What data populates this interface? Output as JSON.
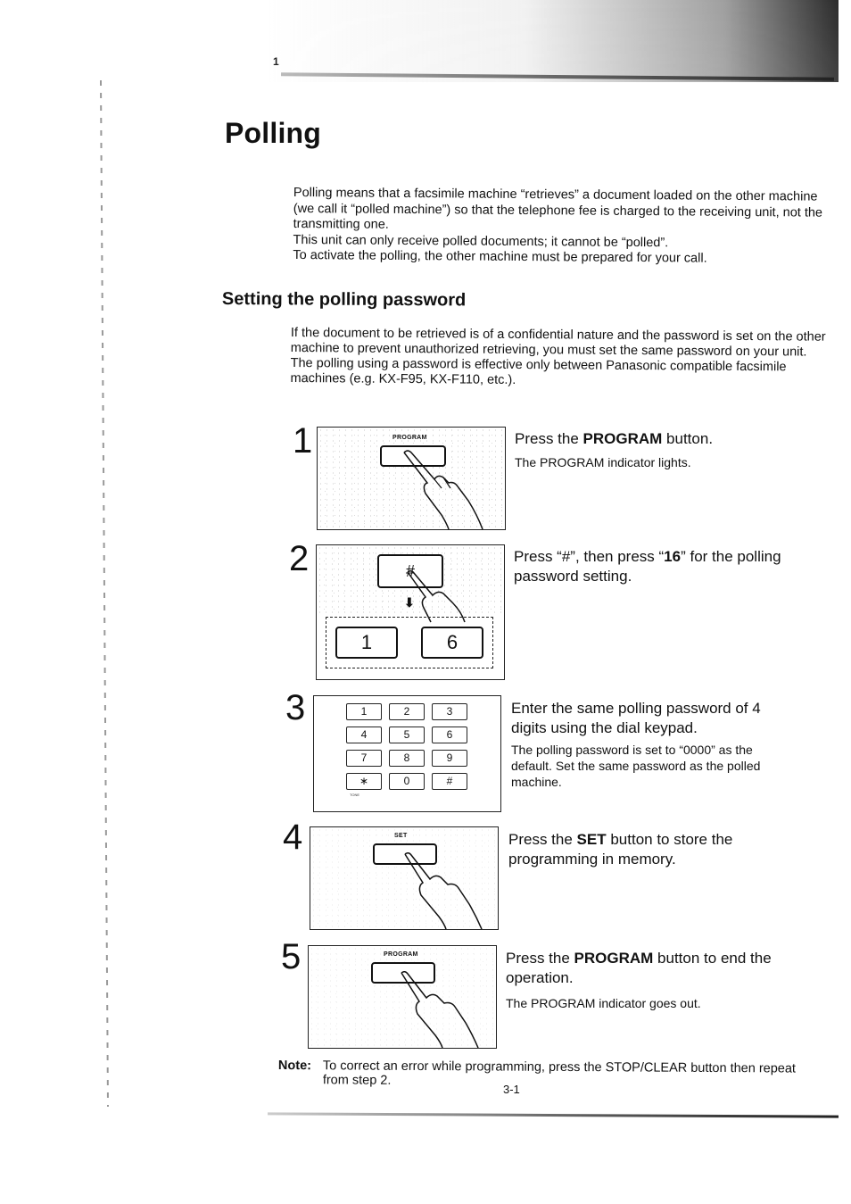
{
  "page": {
    "corner_mark": "1",
    "title": "Polling",
    "page_number": "3-1"
  },
  "intro": {
    "paragraphs": [
      "Polling means that a facsimile machine “retrieves” a document loaded on the other machine (we call it “polled machine”) so that the telephone fee is charged to the receiving unit, not the transmitting one.",
      "This unit can only receive polled documents; it cannot be “polled”.",
      "To activate the polling, the other machine must be prepared for your call."
    ]
  },
  "section": {
    "title": "Setting the polling password",
    "paragraphs": [
      "If the document to be retrieved is of a confidential nature and the password is set on the other machine to prevent unauthorized retrieving, you must set the same password on your unit.",
      "The polling using a password is effective only between Panasonic compatible facsimile machines (e.g. KX-F95, KX-F110, etc.)."
    ]
  },
  "steps": [
    {
      "number": "1",
      "figure_label": "PROGRAM",
      "main_pre": "Press the ",
      "main_bold": "PROGRAM",
      "main_post": " button.",
      "sub": "The PROGRAM indicator lights."
    },
    {
      "number": "2",
      "figure_key": "#",
      "figure_keys_after": [
        "1",
        "6"
      ],
      "main_pre": "Press “#”, then press “",
      "main_bold": "16",
      "main_post": "” for the polling password setting.",
      "sub": ""
    },
    {
      "number": "3",
      "keypad": [
        "1",
        "2",
        "3",
        "4",
        "5",
        "6",
        "7",
        "8",
        "9",
        "∗",
        "0",
        "#"
      ],
      "keypad_sublabel": "TONE",
      "main_pre": "Enter the same polling password of 4 digits using the dial keypad.",
      "main_bold": "",
      "main_post": "",
      "sub": "The polling password is set to “0000” as the default. Set the same password as the polled machine."
    },
    {
      "number": "4",
      "figure_label": "SET",
      "main_pre": "Press the ",
      "main_bold": "SET",
      "main_post": " button to store the programming in memory.",
      "sub": ""
    },
    {
      "number": "5",
      "figure_label": "PROGRAM",
      "main_pre": "Press the ",
      "main_bold": "PROGRAM",
      "main_post": " button to end the operation.",
      "sub": "The PROGRAM indicator goes out."
    }
  ],
  "note": {
    "label": "Note:",
    "text": "To correct an error while programming, press the STOP/CLEAR button then repeat from step 2."
  }
}
